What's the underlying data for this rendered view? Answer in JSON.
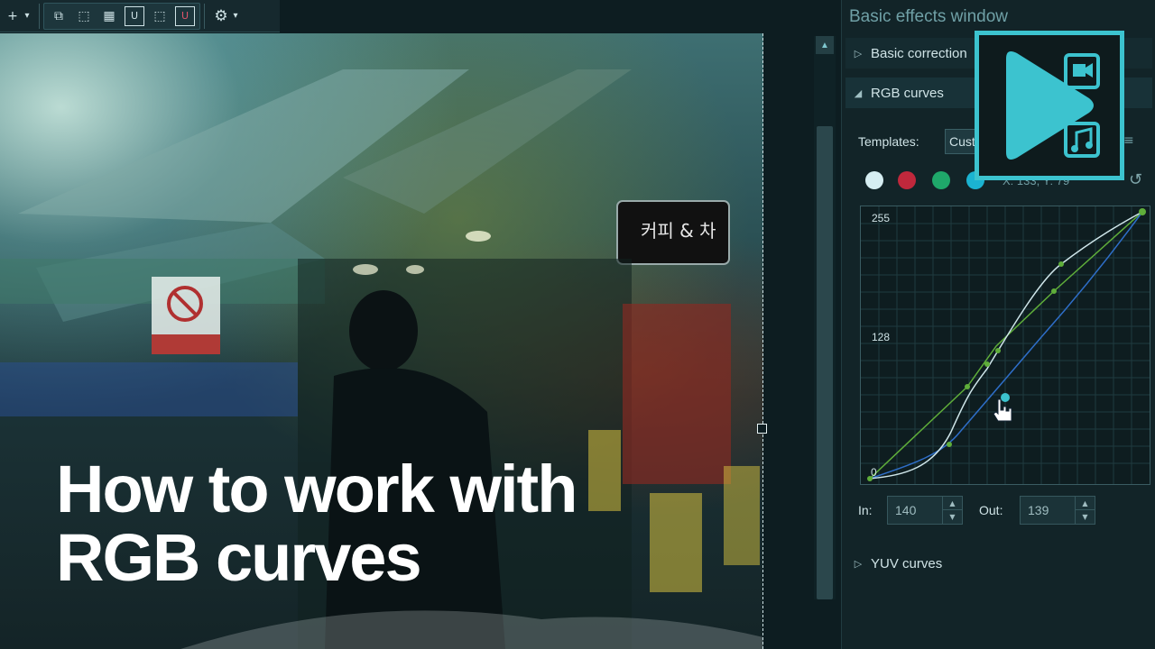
{
  "toolbar": {
    "items": [
      {
        "icon": "add-icon",
        "glyph": "+"
      },
      {
        "icon": "dropdown-arrow-icon",
        "glyph": "▾"
      },
      {
        "icon": "group-icon",
        "glyph": "⧉"
      },
      {
        "icon": "ungroup-icon",
        "glyph": "⬚"
      },
      {
        "icon": "grid-icon",
        "glyph": "▦"
      },
      {
        "icon": "magnet-icon",
        "glyph": "U"
      },
      {
        "icon": "select-frame-icon",
        "glyph": "⬚"
      },
      {
        "icon": "snap-icon",
        "glyph": "U"
      },
      {
        "icon": "settings-icon",
        "glyph": "⚙"
      },
      {
        "icon": "settings-dropdown-icon",
        "glyph": "▾"
      }
    ]
  },
  "overlay": {
    "title_line1": "How to work with",
    "title_line2": "RGB curves"
  },
  "panel": {
    "title": "Basic effects window",
    "pin_glyph": "⊥",
    "sections": {
      "basic": {
        "label": "Basic correction",
        "state": "collapsed"
      },
      "rgb": {
        "label": "RGB curves",
        "state": "expanded"
      },
      "yuv": {
        "label": "YUV curves",
        "state": "collapsed"
      }
    },
    "templates_label": "Templates:",
    "templates_value": "Cust",
    "menu_glyph": "≡",
    "reset_glyph": "↺",
    "channels": [
      {
        "name": "luma",
        "color": "#d6eef2"
      },
      {
        "name": "red",
        "color": "#c0283c"
      },
      {
        "name": "green",
        "color": "#1fa86a"
      },
      {
        "name": "blue",
        "color": "#1bb3d1"
      }
    ],
    "coords": "X: 133, Y: 79",
    "graph": {
      "label_top": "255",
      "label_mid": "128",
      "label_zero": "0"
    },
    "in_label": "In:",
    "in_value": "140",
    "out_label": "Out:",
    "out_value": "139",
    "spin_up": "▲",
    "spin_down": "▼"
  },
  "scrollbar": {
    "up_glyph": "▲"
  },
  "colors": {
    "accent": "#3cc3cf",
    "panel_bg": "#122428",
    "curve_luma": "#cfe6ea",
    "curve_green": "#5fae3a",
    "curve_blue": "#2e6ec8"
  }
}
